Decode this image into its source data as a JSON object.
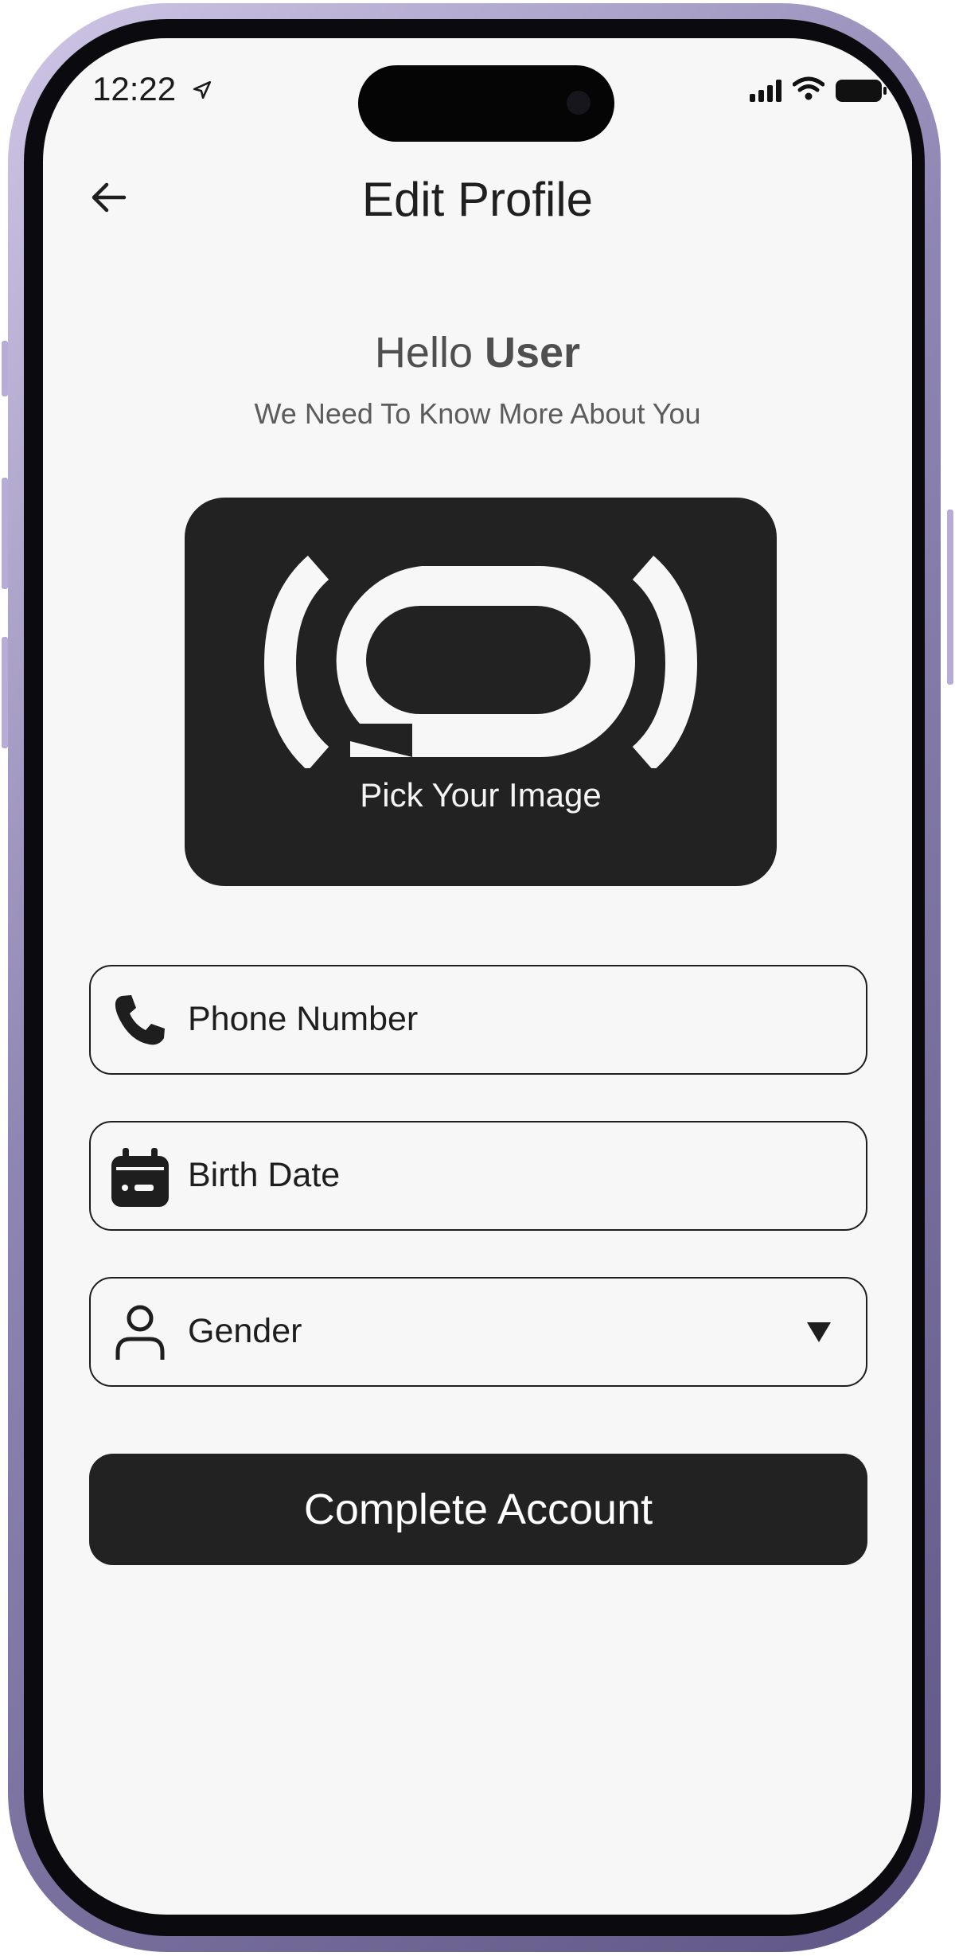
{
  "status_bar": {
    "time": "12:22",
    "location_icon": "location-arrow-icon",
    "signal_icon": "cellular-signal-icon",
    "wifi_icon": "wifi-icon",
    "battery_icon": "battery-icon"
  },
  "header": {
    "back_icon": "arrow-left-icon",
    "title": "Edit Profile"
  },
  "greeting": {
    "hello": "Hello",
    "user": "User",
    "subtitle": "We Need To Know More About You"
  },
  "image_picker": {
    "icon": "camera-shutter-icon",
    "label": "Pick Your Image"
  },
  "form": {
    "phone": {
      "icon": "phone-icon",
      "placeholder": "Phone Number"
    },
    "birth_date": {
      "icon": "calendar-icon",
      "placeholder": "Birth Date"
    },
    "gender": {
      "icon": "person-icon",
      "placeholder": "Gender",
      "dropdown_icon": "dropdown-triangle-icon"
    }
  },
  "complete_button": {
    "label": "Complete Account"
  },
  "colors": {
    "background": "#f7f7f7",
    "primary_dark": "#222222",
    "text": "#1e1e1e",
    "frame": "#8f86b3"
  }
}
